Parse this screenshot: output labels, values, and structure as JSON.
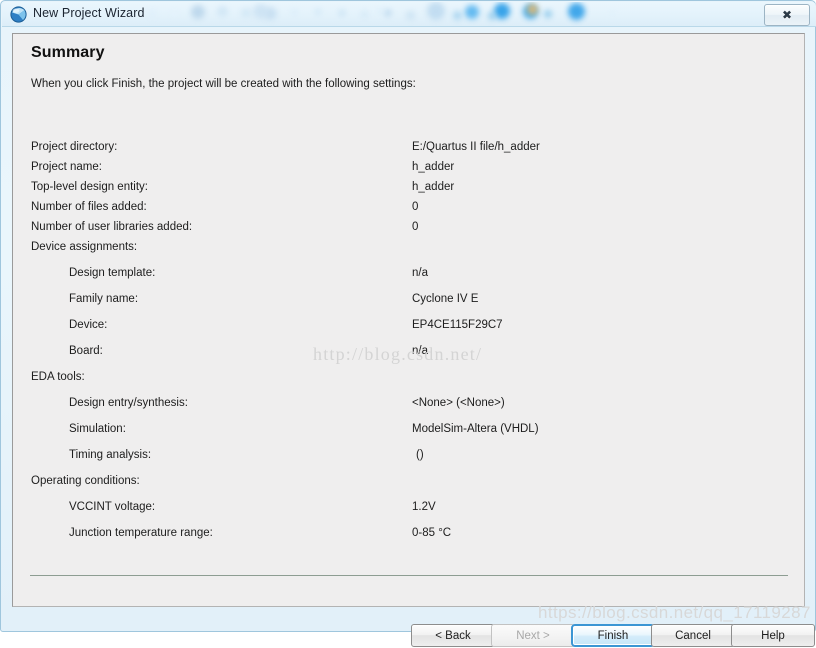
{
  "window": {
    "title": "New Project Wizard",
    "icon": "quartus-sphere-icon",
    "close_label": "✖"
  },
  "page": {
    "title": "Summary",
    "intro": "When you click Finish, the project will be created with the following settings:"
  },
  "summary_rows": [
    {
      "level": 0,
      "label": "Project directory:",
      "value": "E:/Quartus II file/h_adder"
    },
    {
      "level": 0,
      "label": "Project name:",
      "value": "h_adder"
    },
    {
      "level": 0,
      "label": "Top-level design entity:",
      "value": "h_adder"
    },
    {
      "level": 0,
      "label": "Number of files added:",
      "value": "0"
    },
    {
      "level": 0,
      "label": "Number of user libraries added:",
      "value": "0"
    },
    {
      "level": 0,
      "label": "Device assignments:",
      "value": ""
    },
    {
      "level": 1,
      "label": "Design template:",
      "value": "n/a"
    },
    {
      "level": 1,
      "label": "Family name:",
      "value": "Cyclone IV E"
    },
    {
      "level": 1,
      "label": "Device:",
      "value": "EP4CE115F29C7"
    },
    {
      "level": 1,
      "label": "Board:",
      "value": "n/a"
    },
    {
      "level": 0,
      "label": "EDA tools:",
      "value": ""
    },
    {
      "level": 1,
      "label": "Design entry/synthesis:",
      "value": "<None> (<None>)"
    },
    {
      "level": 1,
      "label": "Simulation:",
      "value": "ModelSim-Altera (VHDL)"
    },
    {
      "level": 1,
      "label": "Timing analysis:",
      "value": "()",
      "value_pad": true
    },
    {
      "level": 0,
      "label": "Operating conditions:",
      "value": ""
    },
    {
      "level": 1,
      "label": "VCCINT voltage:",
      "value": "1.2V"
    },
    {
      "level": 1,
      "label": "Junction temperature range:",
      "value": "0-85 °C"
    }
  ],
  "footer": {
    "back_label": "< Back",
    "next_label": "Next >",
    "finish_label": "Finish",
    "cancel_label": "Cancel",
    "help_label": "Help",
    "next_disabled": true,
    "finish_focused": true
  },
  "watermarks": {
    "center": "http://blog.csdn.net/",
    "bottom": "https://blog.csdn.net/qq_17119287"
  },
  "colors": {
    "titlebar_top": "#eaf6fd",
    "panel_bg": "#efeeee",
    "focus_blue": "#3c96d4",
    "text": "#1d1d1d"
  }
}
